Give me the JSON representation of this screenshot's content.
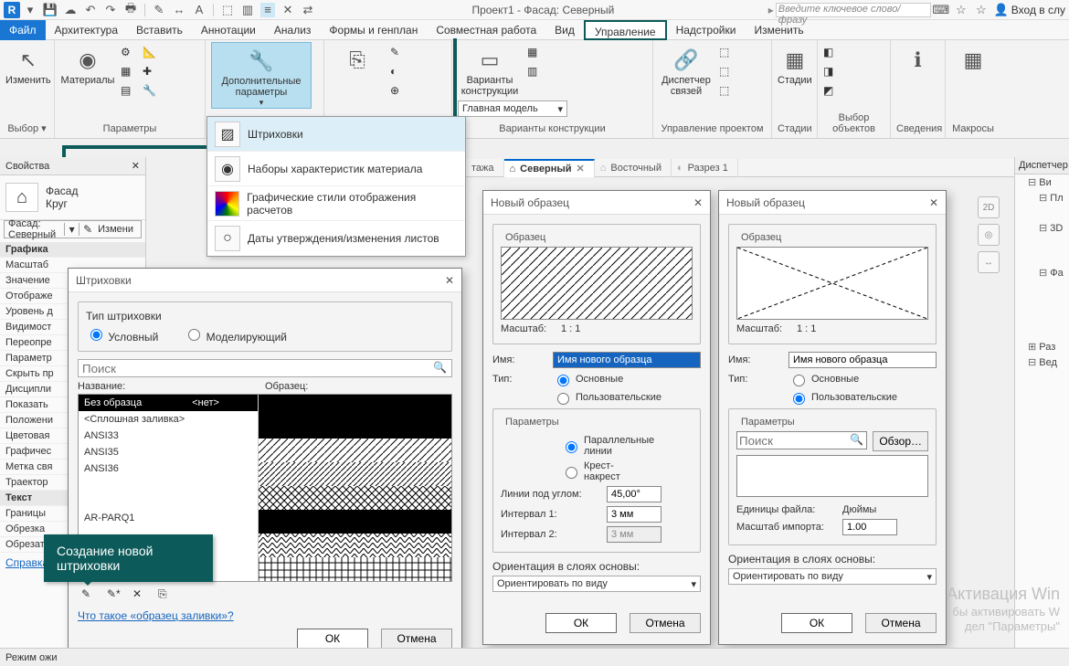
{
  "app": {
    "logo": "R",
    "title": "Проект1 - Фасад: Северный",
    "search_placeholder": "Введите ключевое слово/фразу",
    "login": "Вход в слу"
  },
  "menu": {
    "file": "Файл",
    "arch": "Архитектура",
    "insert": "Вставить",
    "annot": "Аннотации",
    "analyze": "Анализ",
    "mass": "Формы и генплан",
    "collab": "Совместная работа",
    "view": "Вид",
    "manage": "Управление",
    "addins": "Надстройки",
    "modify": "Изменить"
  },
  "ribbon": {
    "modify": "Изменить",
    "select_lbl": "Выбор",
    "materials": "Материалы",
    "settings_lbl": "Параметры",
    "add_params": "Дополнительные параметры",
    "variants": "Варианты конструкции",
    "variants_lbl": "Варианты конструкции",
    "main_model": "Главная модель",
    "link_mgr": "Диспетчер связей",
    "proj_lbl": "Управление проектом",
    "stages": "Стадии",
    "stages_lbl": "Стадии",
    "selobj_lbl": "Выбор объектов",
    "info_lbl": "Сведения",
    "macros_lbl": "Макросы"
  },
  "dropdown": {
    "hatch": "Штриховки",
    "matset": "Наборы характеристик материала",
    "gstyle": "Графические стили отображения расчетов",
    "dates": "Даты утверждения/изменения листов"
  },
  "props": {
    "title": "Свойства",
    "type1": "Фасад",
    "type2": "Круг",
    "combo": "Фасад: Северный",
    "edit": "Измени",
    "cat_graphics": "Графика",
    "rows": [
      "Масштаб",
      "Значение",
      "Отображе",
      "Уровень д",
      "Видимост",
      "Переопре",
      "Параметр",
      "Скрыть пр",
      "Дисципли",
      "Показать",
      "Положени",
      "Цветовая",
      "Графичес",
      "Метка свя",
      "Траектор"
    ],
    "cat_text": "Текст",
    "rows2": [
      "Границы",
      "Обрезка",
      "Обрезать"
    ],
    "help": "Справка по",
    "waiting": "Режим ожи"
  },
  "viewtabs": {
    "placeholder": "тажа",
    "north": "Северный",
    "east": "Восточный",
    "section": "Разрез 1",
    "browser": "Диспетчер"
  },
  "hatch_dlg": {
    "title": "Штриховки",
    "type_lbl": "Тип штриховки",
    "r1": "Условный",
    "r2": "Моделирующий",
    "search": "Поиск",
    "col1": "Название:",
    "col2": "Образец:",
    "rows": [
      "Без образца",
      "<Сплошная заливка>",
      "ANSI33",
      "ANSI35",
      "ANSI36",
      "",
      "",
      "AR-PARQ1"
    ],
    "rowvals": [
      "<нет>"
    ],
    "what": "Что такое «образец заливки»?",
    "ok": "ОК",
    "cancel": "Отмена"
  },
  "tooltip": "Создание новой штриховки",
  "newp": {
    "title": "Новый образец",
    "sample": "Образец",
    "scale": "Масштаб:",
    "scale_val": "1 : 1",
    "name": "Имя:",
    "name_ph": "Имя нового образца",
    "type": "Тип:",
    "type_basic": "Основные",
    "type_custom": "Пользовательские",
    "params": "Параметры",
    "par_lines": "Параллельные линии",
    "cross": "Крест-накрест",
    "angle": "Линии под углом:",
    "angle_val": "45,00°",
    "int1": "Интервал 1:",
    "int1_val": "3 мм",
    "int2": "Интервал 2:",
    "int2_val": "3 мм",
    "search": "Поиск",
    "browse": "Обзор…",
    "units": "Единицы файла:",
    "units_val": "Дюймы",
    "impscale": "Масштаб импорта:",
    "impscale_val": "1.00",
    "orient": "Ориентация в слоях основы:",
    "orient_val": "Ориентировать по виду",
    "ok": "ОК",
    "cancel": "Отмена"
  },
  "pbrowser": {
    "title": "Диспетчер",
    "items": [
      "Ви",
      "Пл",
      "",
      "3D",
      "",
      "",
      "Фа",
      "",
      "",
      "",
      "",
      "Раз",
      "Вед",
      ""
    ]
  },
  "watermark": {
    "a": "Активация Win",
    "b": "бы активировать W",
    "c": "дел \"Параметры\"",
    "d": "Активация",
    "e": "Активация"
  }
}
